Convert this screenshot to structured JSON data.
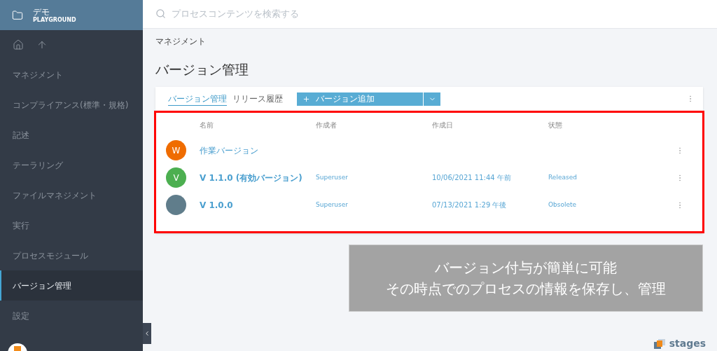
{
  "workspace": {
    "title": "デモ",
    "subtitle": "PLAYGROUND"
  },
  "sidebar": {
    "items": [
      {
        "label": "マネジメント",
        "selected": false
      },
      {
        "label": "コンプライアンス(標準・規格)",
        "selected": false
      },
      {
        "label": "記述",
        "selected": false
      },
      {
        "label": "テーラリング",
        "selected": false
      },
      {
        "label": "ファイルマネジメント",
        "selected": false
      },
      {
        "label": "実行",
        "selected": false
      },
      {
        "label": "プロセスモジュール",
        "selected": false
      },
      {
        "label": "バージョン管理",
        "selected": true
      },
      {
        "label": "設定",
        "selected": false
      }
    ]
  },
  "search": {
    "placeholder": "プロセスコンテンツを検索する"
  },
  "breadcrumb": "マネジメント",
  "page_title": "バージョン管理",
  "tabs": [
    {
      "label": "バージョン管理",
      "selected": true
    },
    {
      "label": "リリース履歴",
      "selected": false
    }
  ],
  "add_button": {
    "label": "バージョン追加"
  },
  "table": {
    "columns": [
      "名前",
      "作成者",
      "作成日",
      "状態"
    ],
    "rows": [
      {
        "kind": "workspace",
        "avatar": "W",
        "color": "#ef6c00",
        "name": "作業バージョン"
      },
      {
        "kind": "version",
        "avatar": "V",
        "color": "#4caf50",
        "name": "V 1.1.0 (有効バージョン)",
        "author": "Superuser",
        "created": "10/06/2021 11:44 午前",
        "status": "Released"
      },
      {
        "kind": "version",
        "color": "#607d8b",
        "name": "V 1.0.0",
        "author": "Superuser",
        "created": "07/13/2021 1:29 午後",
        "status": "Obsolete"
      }
    ]
  },
  "caption": [
    "バージョン付与が簡単に可能",
    "その時点でのプロセスの情報を保存し、管理"
  ],
  "brand": "stages"
}
